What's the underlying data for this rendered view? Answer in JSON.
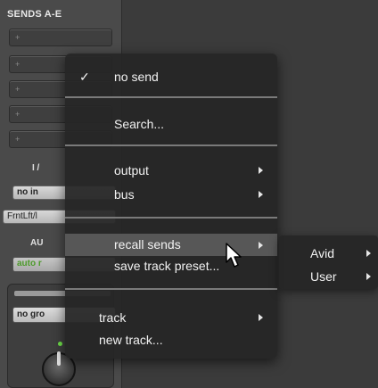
{
  "sends_panel": {
    "title": "SENDS A-E",
    "slot_marker": "+"
  },
  "io": {
    "label": "I /",
    "input_button": "no in",
    "output_button": "FrntLft/l"
  },
  "automation": {
    "label": "AU",
    "mode_button": "auto r"
  },
  "group": {
    "button": "no gro"
  },
  "context_menu": {
    "check_mark": "✓",
    "items": {
      "no_send": "no send",
      "search": "Search...",
      "output": "output",
      "bus": "bus",
      "recall_sends": "recall sends",
      "save_track_preset": "save track preset...",
      "track": "track",
      "new_track": "new track..."
    }
  },
  "submenu": {
    "items": {
      "avid": "Avid",
      "user": "User"
    }
  },
  "colors": {
    "menu_bg": "#262626",
    "highlight": "#575757",
    "auto_text": "#4c9a2a",
    "knob_led": "#6fe24a"
  }
}
